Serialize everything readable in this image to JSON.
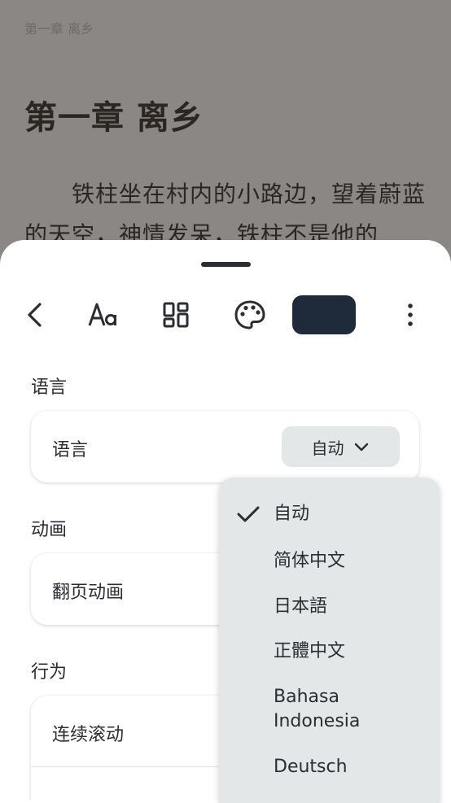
{
  "reader": {
    "running_head": "第一章 离乡",
    "chapter_title": "第一章 离乡",
    "paragraph": "铁柱坐在村内的小路边，望着蔚蓝的天空，神情发呆，铁柱不是他的"
  },
  "settings": {
    "sections": {
      "language": "语言",
      "animation": "动画",
      "behavior": "行为"
    },
    "rows": {
      "language": "语言",
      "page_animation": "翻页动画",
      "continuous_scroll": "连续滚动"
    },
    "language_value": "自动"
  },
  "language_menu": {
    "items": [
      {
        "label": "自动",
        "selected": true
      },
      {
        "label": "简体中文",
        "selected": false
      },
      {
        "label": "日本語",
        "selected": false
      },
      {
        "label": "正體中文",
        "selected": false
      },
      {
        "label": "Bahasa Indonesia",
        "selected": false
      },
      {
        "label": "Deutsch",
        "selected": false
      }
    ]
  },
  "toolbar": {
    "icons": [
      "back-icon",
      "text-format-icon",
      "layout-grid-icon",
      "palette-icon",
      "settings-tab",
      "more-vert-icon"
    ]
  },
  "colors": {
    "accent_dark": "#1f2a3b",
    "menu_bg": "#e4e7e8",
    "text": "#2a2d33"
  }
}
